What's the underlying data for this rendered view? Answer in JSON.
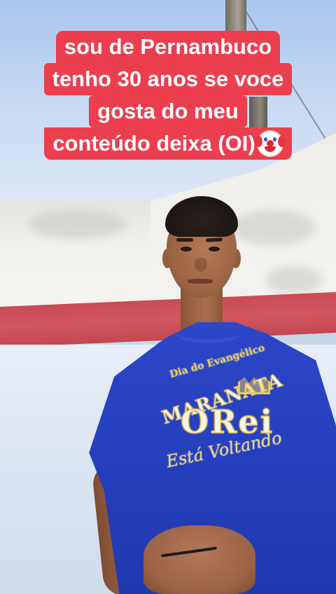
{
  "caption": {
    "lines": [
      "sou de Pernambuco",
      "tenho 30 anos se voce",
      "gosta do meu",
      "conteúdo deixa (OI)"
    ],
    "emoji": "clown-face-icon",
    "background_color": "#eb3f4f",
    "text_color": "#ffffff"
  },
  "shirt_print": {
    "line_1": "Dia do Evangélico",
    "line_2": "MARANATA",
    "line_3": "ORei",
    "line_4": "Está Voltando"
  }
}
